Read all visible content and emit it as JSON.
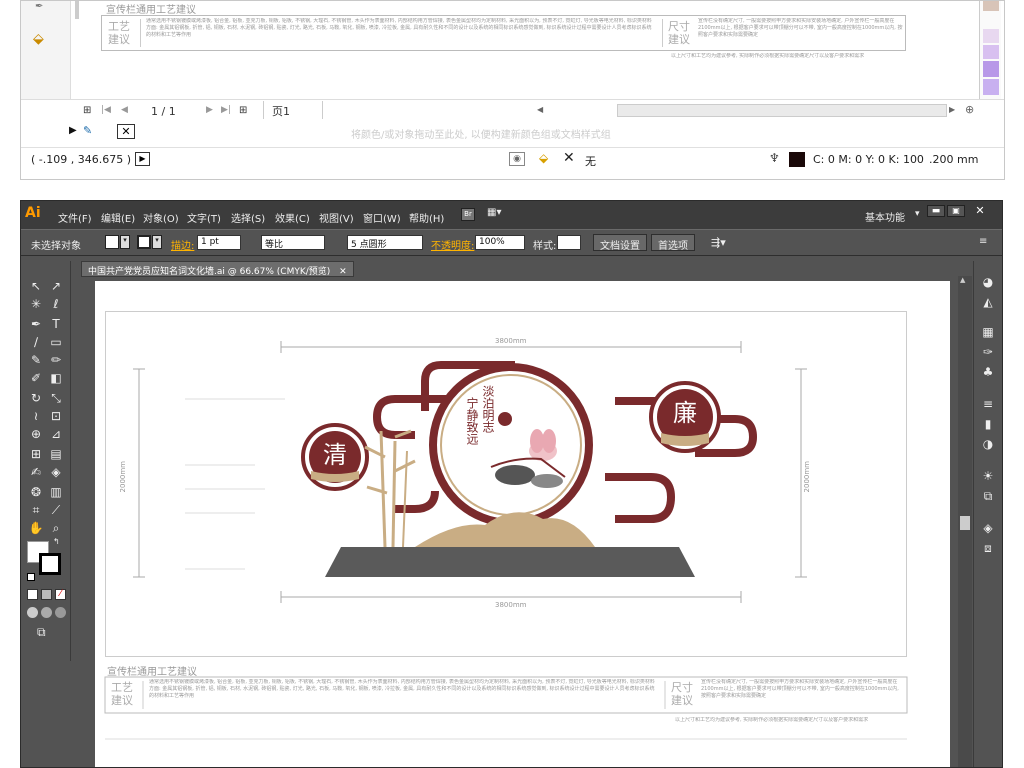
{
  "top_window": {
    "template_title": "宣传栏通用工艺建议",
    "process_label": "工艺\n建议",
    "size_label": "尺寸\n建议",
    "desc_text": "通常选用不锈钢镀膜或烤漆板, 铝合金, 铝板, 亚克力板, 铜板, 铝板, 不锈钢, 大理石, 不锈钢管, 木头作为表面材料, 内部结构用方管焊接, 表色金属型材均为定制材料, 采光面积以为, 预表不灯, 霓虹灯, 导光板等电光材料, 标识类材料方面: 金属其铝钢板, 折管, 铝, 铜板, 石材, 水泥钢, 砖铝钢, 贴瓷, 灯光, 路光, 石板, 马鞍, 氧化, 钢板, 喷漆, 冷拉板, 金属, 具有耐久性和不同的设计以及系统的相同标识系统感觉做到, 标识系统设计过程中需要设计人员考虑标识系统的材料和工艺等作用",
    "size_text": "宣传栏没有确定尺寸, 一般需要按照甲方要求和实际安装场地确定, 户外宣传栏一般高度在2100mm以上, 根据客户要求可以带顶棚分可以不带, 室内一般高度控制在1000mm以内, 按照客户要求和实际需要确定",
    "bottom_note": "以上尺寸和工艺均为建议参考, 实际制作必须根据实际需要确定尺寸以及客户要求和需求",
    "page_indicator": "1 / 1",
    "page_name": "页1",
    "watermark_hint": "将颜色/或对象拖动至此处, 以便构建新颜色组或文档样式组",
    "coords": "( -.109 , 346.675 )",
    "fill_mode": "无",
    "color_readout": "C: 0 M: 0 Y: 0 K: 100",
    "stroke_width": ".200 mm"
  },
  "menubar": {
    "logo": "Ai",
    "items": [
      "文件(F)",
      "编辑(E)",
      "对象(O)",
      "文字(T)",
      "选择(S)",
      "效果(C)",
      "视图(V)",
      "窗口(W)",
      "帮助(H)"
    ],
    "br_label": "Br",
    "workspace": "基本功能"
  },
  "control_bar": {
    "selection_status": "未选择对象",
    "stroke_label": "描边:",
    "stroke_value": "1 pt",
    "line_style": "等比",
    "brush": "5 点圆形",
    "opacity_label": "不透明度:",
    "opacity_value": "100%",
    "style_label": "样式:",
    "doc_setup": "文档设置",
    "preferences": "首选项"
  },
  "document": {
    "tab_title": "中国共产党党员应知名词文化墙.ai @ 66.67% (CMYK/预览)",
    "dim_top": "3800mm",
    "dim_bottom": "3800mm",
    "dim_left": "2000mm",
    "dim_right": "2000mm",
    "char_left": "清",
    "char_right": "廉",
    "motto": [
      "淡泊明志",
      "宁静致远"
    ],
    "seal": "清廉",
    "template_title": "宣传栏通用工艺建议",
    "process_label": "工艺\n建议",
    "size_label": "尺寸\n建议"
  },
  "colors": {
    "accent_red": "#7a2a2c",
    "gold": "#c9ad84",
    "ground": "#5a5a5a",
    "ui_dark": "#535353"
  }
}
